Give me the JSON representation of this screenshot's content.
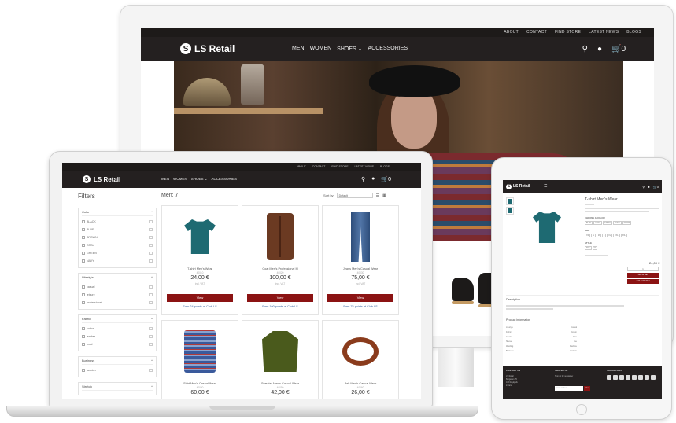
{
  "brand": {
    "name": "LS Retail",
    "logo_glyph": "S",
    "accent": "#8b1313",
    "nav_bg": "#242020"
  },
  "desktop": {
    "top_links": [
      "ABOUT",
      "CONTACT",
      "FIND STORE",
      "LATEST NEWS",
      "BLOGS"
    ],
    "menu": [
      "MEN",
      "WOMEN",
      "SHOES ⌄",
      "ACCESSORIES"
    ],
    "cart_count": "0"
  },
  "laptop": {
    "top_links": [
      "ABOUT",
      "CONTACT",
      "FIND STORE",
      "LATEST NEWS",
      "BLOGS"
    ],
    "menu": [
      "MEN",
      "WOMEN",
      "SHOES ⌄",
      "ACCESSORIES"
    ],
    "cart_count": "0",
    "filters_title": "Filters",
    "results_title": "Men: 7",
    "sort_label": "Sort by",
    "sort_value": "Default",
    "filter_groups": [
      {
        "name": "Color",
        "items": [
          "BLACK",
          "BLUE",
          "BROWN",
          "GRAY",
          "GREEN",
          "NAVY"
        ]
      },
      {
        "name": "Lifestyle",
        "items": [
          "casual",
          "leisure",
          "professional"
        ]
      },
      {
        "name": "Fabric",
        "items": [
          "cotton",
          "leather",
          "wool"
        ]
      },
      {
        "name": "Business",
        "items": [
          "fashion"
        ]
      },
      {
        "name": "Stretch",
        "items": []
      }
    ],
    "products": [
      {
        "name": "T-shirt Men's Wear",
        "sku": "40010",
        "price": "24,00 €",
        "vat": "incl. VAT",
        "button": "View",
        "earn": "Earn 24 points at Club LS",
        "image": "tshirt-icon"
      },
      {
        "name": "Coat Men's Professional M",
        "sku": "40020",
        "price": "100,00 €",
        "vat": "incl. VAT",
        "button": "View",
        "earn": "Earn 100 points at Club LS",
        "image": "coat-icon"
      },
      {
        "name": "Jeans Men's Casual Wear",
        "sku": "40030",
        "price": "75,00 €",
        "vat": "incl. VAT",
        "button": "View",
        "earn": "Earn 75 points at Club LS",
        "image": "jeans-icon"
      },
      {
        "name": "Shirt Men's Casual Wear",
        "sku": "40040",
        "price": "60,00 €",
        "vat": "",
        "button": "",
        "earn": "",
        "image": "shirt-icon"
      },
      {
        "name": "Sweater Men's Casual Wear",
        "sku": "40050",
        "price": "42,00 €",
        "vat": "",
        "button": "",
        "earn": "",
        "image": "sweater-icon"
      },
      {
        "name": "Belt Men's Casual Wear",
        "sku": "40060",
        "price": "26,00 €",
        "vat": "",
        "button": "",
        "earn": "",
        "image": "belt-icon"
      }
    ]
  },
  "tablet": {
    "cart_count": "0",
    "product_title": "T-shirt Men's Wear",
    "color_label": "CHOOSE A COLOR",
    "colors": [
      "BLUE",
      "GRAY",
      "GREEN",
      "NAVY",
      "WHITE"
    ],
    "size_label": "SIZE",
    "sizes": [
      "XS",
      "S",
      "M",
      "L",
      "XL",
      "XXL",
      "3XL"
    ],
    "style_label": "STYLE",
    "styles": [
      "Slim",
      "Fit"
    ],
    "price": "24,00 €",
    "add_to_cart": "Add to cart",
    "wishlist": "Add to Wishlist",
    "description_title": "Description",
    "product_info_title": "Product information",
    "info_rows": [
      {
        "key": "Lifestyle",
        "value": "Casual"
      },
      {
        "key": "Fabric",
        "value": "Cotton"
      },
      {
        "key": "Gender",
        "value": "Men"
      },
      {
        "key": "Sleeve",
        "value": "Tee"
      },
      {
        "key": "Washing",
        "value": "Machine"
      },
      {
        "key": "Business",
        "value": "Fashion"
      }
    ],
    "footer": {
      "contact_title": "CONTACT US",
      "contact_lines": [
        "LS Retail",
        "Borgartun 25",
        "105 Reykjavik",
        "Iceland"
      ],
      "signup_title": "SIGN ME UP",
      "signup_text": "Sign up for newsletter",
      "email_placeholder": "Email address",
      "go_button": "Go",
      "social_title": "SOCIAL LINKS"
    }
  }
}
